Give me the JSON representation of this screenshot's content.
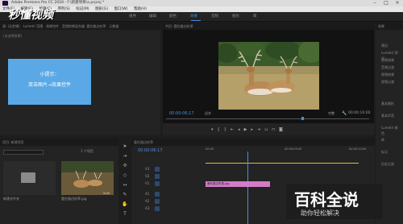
{
  "titlebar": {
    "title": "Adobe Premiere Pro CC 2018 - F:\\新建项目\\a.prproj *"
  },
  "menu": [
    "文件(F)",
    "编辑(E)",
    "剪辑(C)",
    "序列(S)",
    "标记(M)",
    "图形(G)",
    "窗口(W)",
    "帮助(H)"
  ],
  "watermark": {
    "text": "秒懂视频"
  },
  "workspaces": [
    {
      "label": "组件",
      "active": false
    },
    {
      "label": "编辑",
      "active": false
    },
    {
      "label": "颜色",
      "active": false
    },
    {
      "label": "效果",
      "active": true
    },
    {
      "label": "音频",
      "active": false
    },
    {
      "label": "图形",
      "active": false
    },
    {
      "label": "库",
      "active": false
    }
  ],
  "source_panel": {
    "tabs": [
      "源: (无剪辑)",
      "Lumetri 范围",
      "效果控件",
      "音频剪辑混合器: 鹿在路边吃草",
      "元数据"
    ],
    "note": "(未选择剪辑)"
  },
  "tip": {
    "line1": "小提示：",
    "line2": "双击图片→效果控件"
  },
  "program_monitor": {
    "title": "节目: 鹿在路边吃草",
    "timecode_left": "00:00:06:17",
    "fit_label": "适合",
    "quality_label": "完整",
    "timecode_right": "00:00:10:00"
  },
  "project_panel": {
    "title": "项目: 新建项目",
    "search_placeholder": "",
    "items": [
      {
        "name": "新建文件夹",
        "meta": ""
      },
      {
        "name": "鹿在路边吃草.jpg",
        "meta": "5:00"
      }
    ],
    "count_label": "1 个项目",
    "extra_item": "鹿在路边吃草.jpg"
  },
  "timeline": {
    "title": "鹿在路边吃草",
    "timecode": "00:00:06:17",
    "tracks": [
      {
        "name": "V3"
      },
      {
        "name": "V2"
      },
      {
        "name": "V1"
      },
      {
        "name": "A1"
      },
      {
        "name": "A2"
      },
      {
        "name": "A3"
      }
    ],
    "clip_label": "鹿在路边吃草.jpg",
    "ruler": [
      "00:00",
      "00:00:05:00",
      "00:00:10:00"
    ]
  },
  "right_panel": {
    "tabs": [
      "效果"
    ],
    "items": [
      "预设",
      "Lumetri 预设",
      "音频效果",
      "音频过渡",
      "视频效果",
      "视频过渡"
    ],
    "bottom_items": [
      "基本图形",
      "基本声音",
      "Lumetri 颜色",
      "库",
      "标记",
      "历史记录"
    ]
  },
  "baike": {
    "title": "百科全说",
    "subtitle": "助你轻松解决"
  }
}
